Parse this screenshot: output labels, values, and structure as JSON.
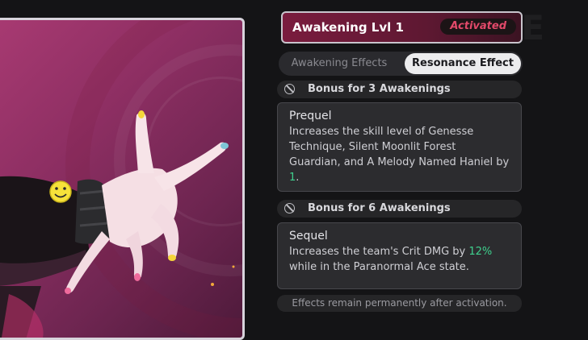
{
  "art": {
    "watermark": "",
    "icon": "smiley-face-icon"
  },
  "panel": {
    "title": "Awakening Lvl 1",
    "status_badge": "Activated",
    "tabs": [
      {
        "label": "Awakening Effects",
        "active": false
      },
      {
        "label": "Resonance Effect",
        "active": true
      }
    ],
    "sections": [
      {
        "header": "Bonus for 3 Awakenings",
        "card_title": "Prequel",
        "desc_before": "Increases the skill level of Genesse Technique, Silent Moonlit Forest Guardian, and A Melody Named Haniel by ",
        "desc_value": "1",
        "desc_after": "."
      },
      {
        "header": "Bonus for 6 Awakenings",
        "card_title": "Sequel",
        "desc_before": "Increases the team's Crit DMG by ",
        "desc_value": "12%",
        "desc_after": " while in the Paranormal Ace state."
      }
    ],
    "footer": "Effects remain permanently after activation."
  },
  "colors": {
    "title_bg": "#7a1c3e",
    "badge_text": "#e2496a",
    "highlight": "#3fd18e",
    "art_bg": "#8e2f63"
  }
}
